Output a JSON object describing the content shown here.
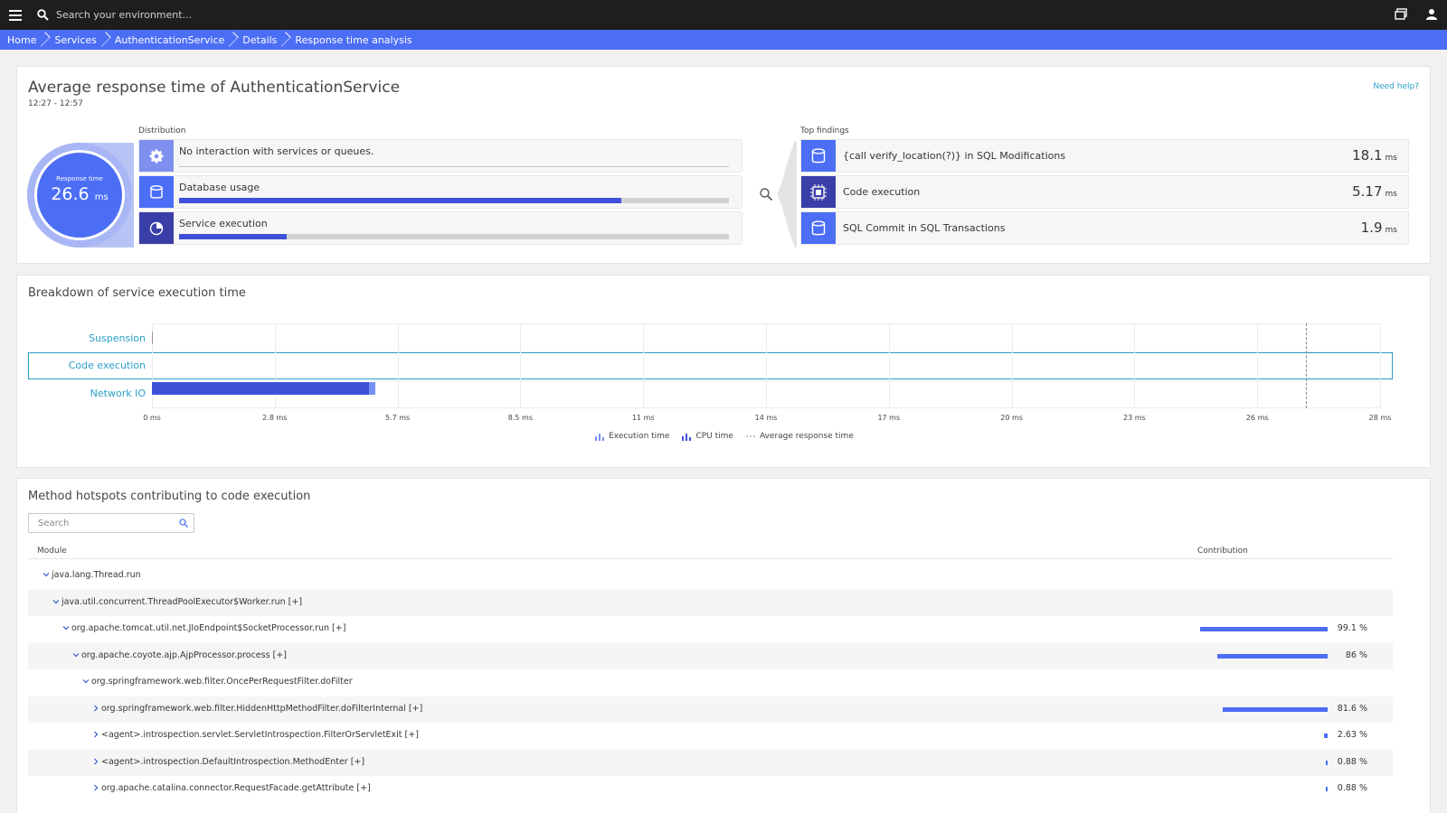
{
  "topbar": {
    "menu_icon": "hamburger-menu-icon",
    "search_placeholder": "Search your environment...",
    "windows_icon": "windows-icon",
    "user_icon": "user-icon"
  },
  "breadcrumb": [
    "Home",
    "Services",
    "AuthenticationService",
    "Details",
    "Response time analysis"
  ],
  "summary": {
    "title": "Average response time of AuthenticationService",
    "timerange": "12:27 - 12:57",
    "help": "Need help?",
    "response_label": "Response time",
    "response_value": "26.6",
    "response_unit": "ms",
    "distribution_label": "Distribution",
    "distribution": [
      {
        "label": "No interaction with services or queues.",
        "icon": "gear-icon",
        "icon_bg": "#7f8ff0",
        "fill": 0
      },
      {
        "label": "Database usage",
        "icon": "database-icon",
        "icon_bg": "#4c6ef5",
        "fill": 0.805
      },
      {
        "label": "Service execution",
        "icon": "service-execution-icon",
        "icon_bg": "#3a3fa8",
        "fill": 0.196
      }
    ],
    "top_findings_label": "Top findings",
    "top_findings": [
      {
        "label": "{call verify_location(?)} in SQL Modifications",
        "value": "18.1",
        "unit": "ms",
        "icon": "database-icon",
        "icon_bg": "#4c6ef5"
      },
      {
        "label": "Code execution",
        "value": "5.17",
        "unit": "ms",
        "icon": "cpu-chip-icon",
        "icon_bg": "#3a3fa8"
      },
      {
        "label": "SQL Commit in SQL Transactions",
        "value": "1.9",
        "unit": "ms",
        "icon": "database-icon",
        "icon_bg": "#4c6ef5"
      }
    ]
  },
  "breakdown": {
    "title": "Breakdown of service execution time",
    "rows": [
      "Suspension",
      "Code execution",
      "Network IO"
    ],
    "ticks": [
      "0 ms",
      "2.8 ms",
      "5.7 ms",
      "8.5 ms",
      "11 ms",
      "14 ms",
      "17 ms",
      "20 ms",
      "23 ms",
      "26 ms",
      "28 ms"
    ],
    "legend": [
      "Execution time",
      "CPU time",
      "Average response time"
    ]
  },
  "chart_data": {
    "type": "bar",
    "orientation": "horizontal",
    "categories": [
      "Suspension",
      "Code execution",
      "Network IO"
    ],
    "series": [
      {
        "name": "Execution time",
        "values": [
          0,
          5.0,
          0
        ]
      },
      {
        "name": "CPU time",
        "values": [
          0,
          0.15,
          0
        ]
      }
    ],
    "average_response_time": 26.6,
    "xlim": [
      0,
      28.3
    ],
    "grid": true,
    "legend_position": "bottom"
  },
  "hotspots": {
    "title": "Method hotspots contributing to code execution",
    "search_placeholder": "Search",
    "col_module": "Module",
    "col_contribution": "Contribution",
    "rows": [
      {
        "text": "java.lang.Thread.run",
        "level": 0,
        "expanded": true,
        "pct": "",
        "fraction": 0
      },
      {
        "text": "java.util.concurrent.ThreadPoolExecutor$Worker.run [+]",
        "level": 1,
        "expanded": true,
        "pct": "",
        "fraction": 0
      },
      {
        "text": "org.apache.tomcat.util.net.JIoEndpoint$SocketProcessor.run [+]",
        "level": 2,
        "expanded": true,
        "pct": "99.1 %",
        "fraction": 0.991
      },
      {
        "text": "org.apache.coyote.ajp.AjpProcessor.process [+]",
        "level": 3,
        "expanded": true,
        "pct": "86 %",
        "fraction": 0.86
      },
      {
        "text": "org.springframework.web.filter.OncePerRequestFilter.doFilter",
        "level": 4,
        "expanded": true,
        "pct": "",
        "fraction": 0
      },
      {
        "text": "org.springframework.web.filter.HiddenHttpMethodFilter.doFilterInternal [+]",
        "level": 5,
        "expanded": false,
        "pct": "81.6 %",
        "fraction": 0.816
      },
      {
        "text": "<agent>.introspection.servlet.ServletIntrospection.FilterOrServletExit [+]",
        "level": 5,
        "expanded": false,
        "pct": "2.63 %",
        "fraction": 0.0263
      },
      {
        "text": "<agent>.introspection.DefaultIntrospection.MethodEnter [+]",
        "level": 5,
        "expanded": false,
        "pct": "0.88 %",
        "fraction": 0.0088
      },
      {
        "text": "org.apache.catalina.connector.RequestFacade.getAttribute [+]",
        "level": 5,
        "expanded": false,
        "pct": "0.88 %",
        "fraction": 0.0088
      }
    ]
  }
}
